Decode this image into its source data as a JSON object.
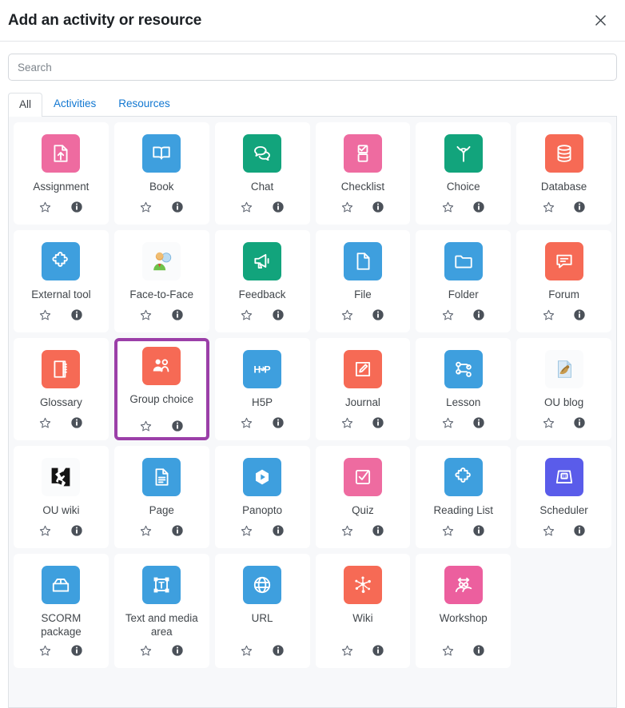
{
  "header": {
    "title": "Add an activity or resource",
    "close_label": "×",
    "close_icon": "close-icon"
  },
  "search": {
    "placeholder": "Search",
    "value": ""
  },
  "tabs": [
    {
      "label": "All",
      "active": true
    },
    {
      "label": "Activities",
      "active": false
    },
    {
      "label": "Resources",
      "active": false
    }
  ],
  "card_actions": {
    "favorite_icon": "star-outline-icon",
    "favorite_label": "Add to favourites",
    "info_icon": "info-circle-icon",
    "info_label": "Help with this activity"
  },
  "colors": {
    "pink": "#ee6ba0",
    "blue": "#3e9fde",
    "green": "#12a47c",
    "orange": "#f66a55",
    "indigo": "#5a5cea",
    "magenta": "#ec5f9e",
    "selected_border": "#9b3fa8",
    "panel_bg": "#f7f8fa",
    "card_bg": "#ffffff",
    "tab_link": "#1177d1"
  },
  "items": [
    {
      "label": "Assignment",
      "icon": "assignment-icon",
      "color": "pink",
      "selected": false
    },
    {
      "label": "Book",
      "icon": "book-icon",
      "color": "blue",
      "selected": false
    },
    {
      "label": "Chat",
      "icon": "chat-bubbles-icon",
      "color": "green",
      "selected": false
    },
    {
      "label": "Checklist",
      "icon": "checklist-icon",
      "color": "pink",
      "selected": false
    },
    {
      "label": "Choice",
      "icon": "fork-branch-icon",
      "color": "green",
      "selected": false
    },
    {
      "label": "Database",
      "icon": "database-icon",
      "color": "orange",
      "selected": false
    },
    {
      "label": "External tool",
      "icon": "puzzle-piece-icon",
      "color": "blue",
      "selected": false
    },
    {
      "label": "Face-to-Face",
      "icon": "person-photo-icon",
      "color": "photo",
      "selected": false
    },
    {
      "label": "Feedback",
      "icon": "megaphone-icon",
      "color": "green",
      "selected": false
    },
    {
      "label": "File",
      "icon": "file-icon",
      "color": "blue",
      "selected": false
    },
    {
      "label": "Folder",
      "icon": "folder-icon",
      "color": "blue",
      "selected": false
    },
    {
      "label": "Forum",
      "icon": "forum-speech-icon",
      "color": "orange",
      "selected": false
    },
    {
      "label": "Glossary",
      "icon": "glossary-book-icon",
      "color": "orange",
      "selected": false
    },
    {
      "label": "Group choice",
      "icon": "group-people-icon",
      "color": "orange",
      "selected": true
    },
    {
      "label": "H5P",
      "icon": "h5p-icon",
      "color": "blue",
      "selected": false
    },
    {
      "label": "Journal",
      "icon": "journal-pencil-icon",
      "color": "orange",
      "selected": false
    },
    {
      "label": "Lesson",
      "icon": "lesson-nodes-icon",
      "color": "blue",
      "selected": false
    },
    {
      "label": "OU blog",
      "icon": "ou-blog-photo-icon",
      "color": "photo",
      "selected": false
    },
    {
      "label": "OU wiki",
      "icon": "ou-wiki-photo-icon",
      "color": "photo",
      "selected": false
    },
    {
      "label": "Page",
      "icon": "page-document-icon",
      "color": "blue",
      "selected": false
    },
    {
      "label": "Panopto",
      "icon": "play-video-icon",
      "color": "blue",
      "selected": false
    },
    {
      "label": "Quiz",
      "icon": "quiz-check-icon",
      "color": "pink",
      "selected": false
    },
    {
      "label": "Reading List",
      "icon": "puzzle-piece-icon",
      "color": "blue",
      "selected": false
    },
    {
      "label": "Scheduler",
      "icon": "calendar-31-icon",
      "color": "indigo",
      "selected": false
    },
    {
      "label": "SCORM package",
      "icon": "package-box-icon",
      "color": "blue",
      "selected": false
    },
    {
      "label": "Text and media area",
      "icon": "text-area-icon",
      "color": "blue",
      "selected": false
    },
    {
      "label": "URL",
      "icon": "globe-icon",
      "color": "blue",
      "selected": false
    },
    {
      "label": "Wiki",
      "icon": "wiki-network-icon",
      "color": "orange",
      "selected": false
    },
    {
      "label": "Workshop",
      "icon": "workshop-people-icon",
      "color": "magenta",
      "selected": false
    }
  ]
}
